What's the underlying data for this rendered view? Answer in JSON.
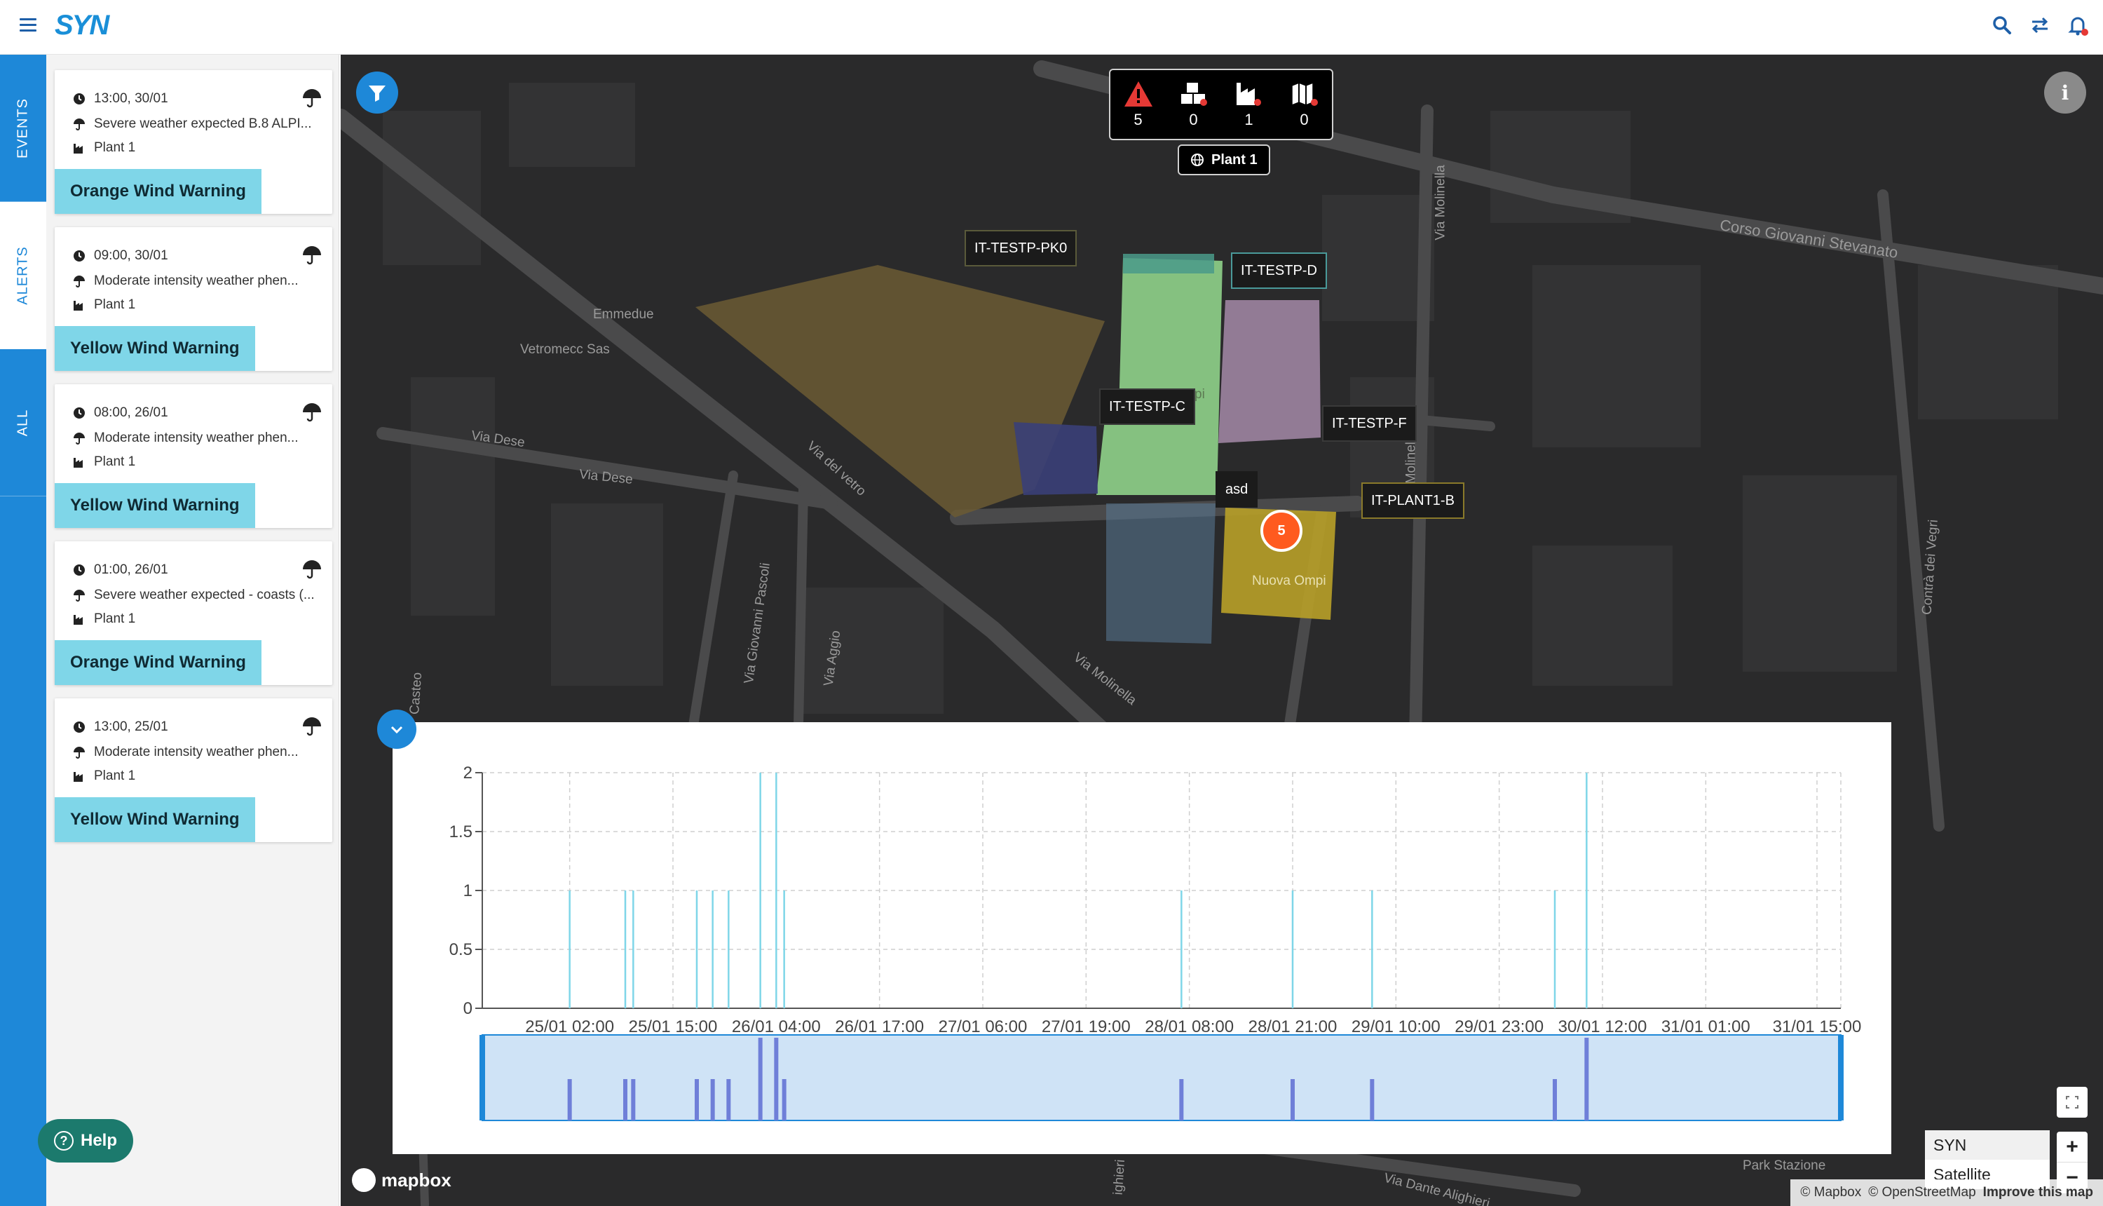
{
  "app": {
    "logo": "SYN"
  },
  "rail": {
    "tabs": [
      "EVENTS",
      "ALERTS",
      "ALL"
    ],
    "active": "ALERTS"
  },
  "events": [
    {
      "time": "13:00, 30/01",
      "description": "Severe weather expected B.8 ALPI...",
      "plant": "Plant 1",
      "warning": "Orange Wind Warning"
    },
    {
      "time": "09:00, 30/01",
      "description": "Moderate intensity weather phen...",
      "plant": "Plant 1",
      "warning": "Yellow Wind Warning"
    },
    {
      "time": "08:00, 26/01",
      "description": "Moderate intensity weather phen...",
      "plant": "Plant 1",
      "warning": "Yellow Wind Warning"
    },
    {
      "time": "01:00, 26/01",
      "description": "Severe weather expected - coasts (...",
      "plant": "Plant 1",
      "warning": "Orange Wind Warning"
    },
    {
      "time": "13:00, 25/01",
      "description": "Moderate intensity weather phen...",
      "plant": "Plant 1",
      "warning": "Yellow Wind Warning"
    }
  ],
  "help": {
    "label": "Help"
  },
  "summary": {
    "alerts": "5",
    "events": "0",
    "plants_down": "1",
    "maps": "0",
    "plant_pill": "Plant 1"
  },
  "map": {
    "plant_tags": [
      "IT-TESTP-PK0",
      "IT-TESTP-D",
      "IT-TESTP-C",
      "IT-TESTP-F",
      "asd",
      "IT-PLANT1-B"
    ],
    "cluster_count": "5",
    "street_labels": [
      "Emmedue",
      "Vetromecc Sas",
      "Via Dese",
      "Via Dese",
      "Via del vetro",
      "Corso Giovanni Stevanato",
      "Via Molinella",
      "Via Molinella",
      "Via Giovanni Pascoli",
      "Via Aggio",
      "Contrà dei Vegri",
      "Nuova Ompi",
      "Via Dante Alighieri",
      "Park Stazione",
      "Casteo",
      "ighieri",
      "Via Molinella",
      "pi"
    ],
    "layers": [
      "SYN",
      "Satellite"
    ],
    "selected_layer": "SYN",
    "zoom_in": "+",
    "zoom_out": "−",
    "mapbox": "mapbox",
    "attribution": [
      "© Mapbox",
      "© OpenStreetMap",
      "Improve this map"
    ]
  },
  "chart_data": {
    "type": "bar",
    "y_ticks": [
      "0",
      "0.5",
      "1",
      "1.5",
      "2"
    ],
    "ylim": [
      0,
      2
    ],
    "x_ticks": [
      "25/01 02:00",
      "25/01 15:00",
      "26/01 04:00",
      "26/01 17:00",
      "27/01 06:00",
      "27/01 19:00",
      "28/01 08:00",
      "28/01 21:00",
      "29/01 10:00",
      "29/01 23:00",
      "30/01 12:00",
      "31/01 01:00",
      "31/01 15:00"
    ],
    "x_hours": [
      0,
      13,
      26,
      39,
      52,
      65,
      78,
      91,
      104,
      117,
      130,
      143,
      157
    ],
    "xlim_hours": [
      -11,
      160
    ],
    "points": [
      {
        "h": 0,
        "v": 1
      },
      {
        "h": 7,
        "v": 1
      },
      {
        "h": 8,
        "v": 1
      },
      {
        "h": 16,
        "v": 1
      },
      {
        "h": 18,
        "v": 1
      },
      {
        "h": 20,
        "v": 1
      },
      {
        "h": 24,
        "v": 2
      },
      {
        "h": 26,
        "v": 2
      },
      {
        "h": 27,
        "v": 1
      },
      {
        "h": 77,
        "v": 1
      },
      {
        "h": 91,
        "v": 1
      },
      {
        "h": 101,
        "v": 1
      },
      {
        "h": 124,
        "v": 1
      },
      {
        "h": 128,
        "v": 2
      }
    ],
    "line_color": "#7fd6e8",
    "brush_color": "#cfe3f6",
    "brush_bar_color": "#6f7fd8"
  }
}
